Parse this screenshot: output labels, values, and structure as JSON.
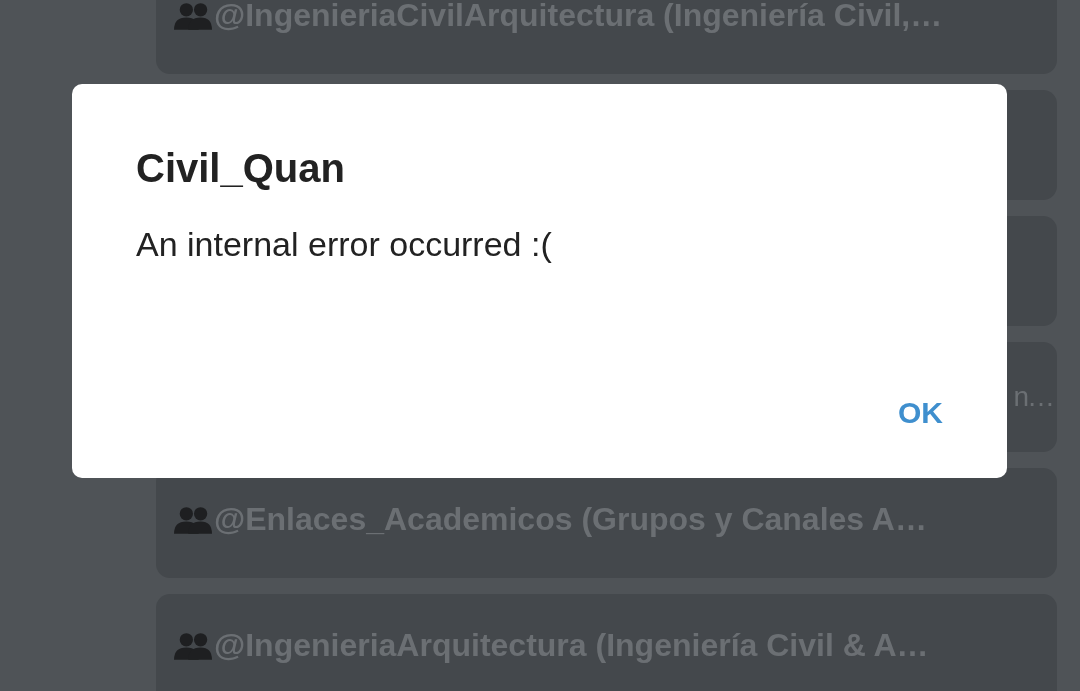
{
  "chat": {
    "messages": [
      {
        "kind": "full",
        "text": "@IngenieriaCivilArquitectura (Ingeniería Civil,…"
      },
      {
        "kind": "hidden"
      },
      {
        "kind": "hidden"
      },
      {
        "kind": "cut",
        "text": "n…"
      },
      {
        "kind": "full",
        "text": "@Enlaces_Academicos (Grupos y Canales A…"
      },
      {
        "kind": "full",
        "text": "@IngenieriaArquitectura (Ingeniería Civil & A…"
      }
    ]
  },
  "dialog": {
    "title": "Civil_Quan",
    "message": "An internal error occurred :(",
    "buttons": [
      "OK"
    ]
  }
}
